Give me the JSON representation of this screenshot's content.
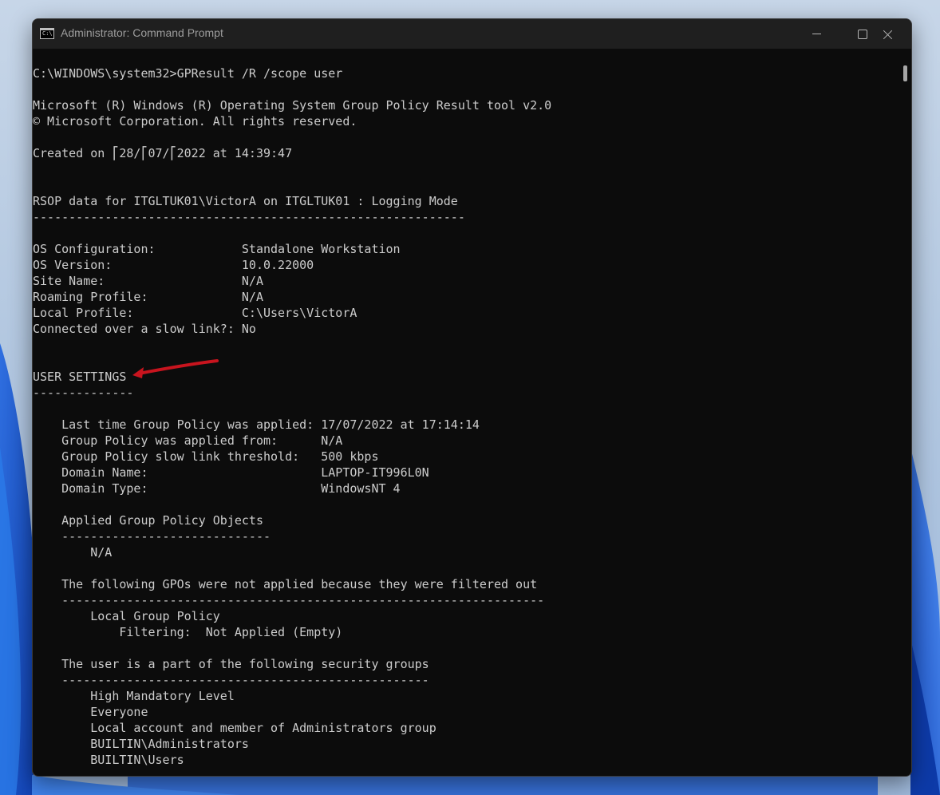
{
  "window": {
    "title": "Administrator: Command Prompt",
    "icon_label": "C:\\",
    "caption_icons": [
      "minimize-icon",
      "maximize-icon",
      "close-icon"
    ]
  },
  "console": {
    "lines": [
      "C:\\WINDOWS\\system32>GPResult /R /scope user",
      "",
      "Microsoft (R) Windows (R) Operating System Group Policy Result tool v2.0",
      "© Microsoft Corporation. All rights reserved.",
      "",
      "Created on ⎡28/⎡07/⎡2022 at 14:39:47",
      "",
      "",
      "RSOP data for ITGLTUK01\\VictorA on ITGLTUK01 : Logging Mode",
      "------------------------------------------------------------",
      "",
      "OS Configuration:            Standalone Workstation",
      "OS Version:                  10.0.22000",
      "Site Name:                   N/A",
      "Roaming Profile:             N/A",
      "Local Profile:               C:\\Users\\VictorA",
      "Connected over a slow link?: No",
      "",
      "",
      "USER SETTINGS",
      "--------------",
      "",
      "    Last time Group Policy was applied: 17/07/2022 at 17:14:14",
      "    Group Policy was applied from:      N/A",
      "    Group Policy slow link threshold:   500 kbps",
      "    Domain Name:                        LAPTOP-IT996L0N",
      "    Domain Type:                        WindowsNT 4",
      "",
      "    Applied Group Policy Objects",
      "    -----------------------------",
      "        N/A",
      "",
      "    The following GPOs were not applied because they were filtered out",
      "    -------------------------------------------------------------------",
      "        Local Group Policy",
      "            Filtering:  Not Applied (Empty)",
      "",
      "    The user is a part of the following security groups",
      "    ---------------------------------------------------",
      "        High Mandatory Level",
      "        Everyone",
      "        Local account and member of Administrators group",
      "        BUILTIN\\Administrators",
      "        BUILTIN\\Users"
    ]
  },
  "annotation": {
    "arrow_color": "#c8141e",
    "points_to": "USER SETTINGS"
  },
  "colors": {
    "console_bg": "#0c0c0c",
    "console_text": "#cccccc",
    "titlebar_bg": "#1f1f1f",
    "title_text": "#9c9c9c"
  }
}
